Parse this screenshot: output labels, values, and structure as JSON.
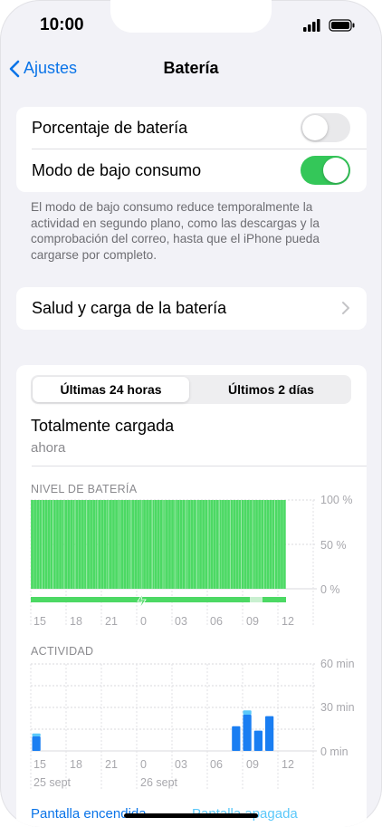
{
  "status": {
    "time": "10:00"
  },
  "nav": {
    "back_label": "Ajustes",
    "title": "Batería"
  },
  "settings": {
    "battery_percentage": {
      "label": "Porcentaje de batería",
      "on": false
    },
    "low_power_mode": {
      "label": "Modo de bajo consumo",
      "on": true
    },
    "footnote": "El modo de bajo consumo reduce temporalmente la actividad en segundo plano, como las descargas y la comprobación del correo, hasta que el iPhone pueda cargarse por completo."
  },
  "health": {
    "label": "Salud y carga de la batería"
  },
  "usage": {
    "tabs": [
      "Últimas 24 horas",
      "Últimos 2 días"
    ],
    "selected_tab": 0,
    "status_title": "Totalmente cargada",
    "status_sub": "ahora",
    "battery_level_label": "NIVEL DE BATERÍA",
    "activity_label": "ACTIVIDAD",
    "legend": {
      "screen_on": "Pantalla encendida",
      "screen_off": "Pantalla apagada"
    }
  },
  "colors": {
    "accent": "#0a74e8",
    "toggle_on": "#34c759",
    "toggle_off": "#e9e9eb",
    "battery_green": "#4cd964",
    "activity_blue": "#1a7ef2",
    "activity_light": "#5ac8fa"
  },
  "chart_data": [
    {
      "type": "bar",
      "title": "NIVEL DE BATERÍA",
      "x_tick_labels": [
        "15",
        "18",
        "21",
        "0",
        "03",
        "06",
        "09",
        "12"
      ],
      "y_tick_labels": [
        "100 %",
        "50 %",
        "0 %"
      ],
      "ylim": [
        0,
        100
      ],
      "start_hour": 14,
      "end_hour": 13,
      "series": [
        {
          "values_percent": [
            100,
            100,
            100,
            100,
            100,
            100,
            100,
            100,
            100,
            100,
            100,
            100,
            100,
            100,
            100,
            100,
            100,
            100,
            100,
            100,
            100,
            100,
            100
          ]
        }
      ]
    },
    {
      "type": "bar",
      "title": "ACTIVIDAD",
      "x_tick_labels": [
        "15",
        "18",
        "21",
        "0",
        "03",
        "06",
        "09",
        "12"
      ],
      "y_tick_labels": [
        "60 min",
        "30 min",
        "0 min"
      ],
      "date_labels": [
        "25 sept",
        "26 sept"
      ],
      "ylim": [
        0,
        60
      ],
      "categories_hour": [
        14,
        15,
        16,
        17,
        18,
        19,
        20,
        21,
        22,
        23,
        0,
        1,
        2,
        3,
        4,
        5,
        6,
        7,
        8,
        9,
        10,
        11,
        12
      ],
      "series": [
        {
          "name": "Pantalla encendida",
          "values": [
            10,
            0,
            0,
            0,
            0,
            0,
            0,
            0,
            0,
            0,
            0,
            0,
            0,
            0,
            0,
            0,
            0,
            0,
            17,
            25,
            14,
            24,
            0
          ]
        },
        {
          "name": "Pantalla apagada",
          "values": [
            2,
            0,
            0,
            0,
            0,
            0,
            0,
            0,
            0,
            0,
            0,
            0,
            0,
            0,
            0,
            0,
            0,
            0,
            0,
            3,
            0,
            0,
            0
          ]
        }
      ]
    }
  ]
}
